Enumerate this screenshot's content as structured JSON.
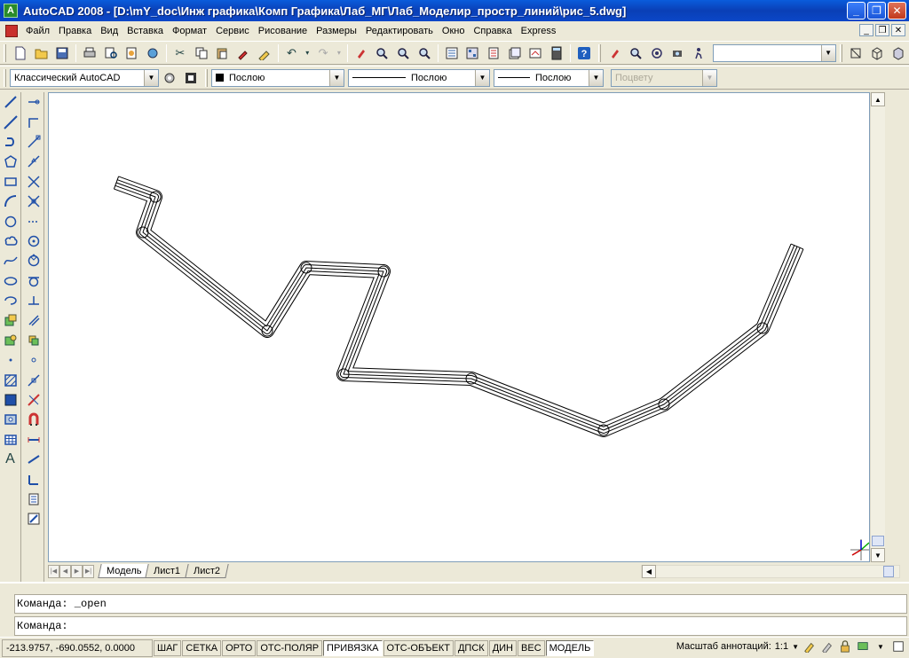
{
  "window": {
    "title": "AutoCAD 2008 - [D:\\mY_doc\\Инж графика\\Комп Графика\\Лаб_МГ\\Лаб_Моделир_простр_линий\\рис_5.dwg]",
    "icon_label": "A"
  },
  "menu": {
    "items": [
      {
        "label": "Файл"
      },
      {
        "label": "Правка"
      },
      {
        "label": "Вид"
      },
      {
        "label": "Вставка"
      },
      {
        "label": "Формат"
      },
      {
        "label": "Сервис"
      },
      {
        "label": "Рисование"
      },
      {
        "label": "Размеры"
      },
      {
        "label": "Редактировать"
      },
      {
        "label": "Окно"
      },
      {
        "label": "Справка"
      },
      {
        "label": "Express"
      }
    ]
  },
  "toolbar2": {
    "workspace": "Классический AutoCAD",
    "layer": "Послою",
    "linetype": "Послою",
    "lineweight": "Послою",
    "plotstyle": "Поцвету"
  },
  "tabs": [
    {
      "label": "Модель",
      "active": true
    },
    {
      "label": "Лист1",
      "active": false
    },
    {
      "label": "Лист2",
      "active": false
    }
  ],
  "command": {
    "history": "Команда:  _open",
    "prompt": "Команда:"
  },
  "status": {
    "coordinates": "-213.9757, -690.0552, 0.0000",
    "toggles": [
      {
        "label": "ШАГ",
        "on": false
      },
      {
        "label": "СЕТКА",
        "on": false
      },
      {
        "label": "ОРТО",
        "on": false
      },
      {
        "label": "ОТС-ПОЛЯР",
        "on": false
      },
      {
        "label": "ПРИВЯЗКА",
        "on": true
      },
      {
        "label": "ОТС-ОБЪЕКТ",
        "on": false
      },
      {
        "label": "ДПСК",
        "on": false
      },
      {
        "label": "ДИН",
        "on": false
      },
      {
        "label": "ВЕС",
        "on": false
      },
      {
        "label": "МОДЕЛЬ",
        "on": true
      }
    ],
    "annotation_scale_label": "Масштаб аннотаций:",
    "annotation_scale_value": "1:1"
  },
  "icons": {
    "toolbar1": [
      "new-icon",
      "open-icon",
      "save-icon",
      "plot-icon",
      "plot-preview-icon",
      "publish-icon",
      "3d-dwf-icon",
      "cut-icon",
      "copy-icon",
      "paste-icon",
      "match-properties-icon",
      "block-editor-icon",
      "undo-icon",
      "redo-icon",
      "pan-icon",
      "zoom-realtime-icon",
      "zoom-window-icon",
      "zoom-previous-icon",
      "properties-icon",
      "design-center-icon",
      "tool-palettes-icon",
      "sheet-set-icon",
      "markup-icon",
      "calculator-icon",
      "help-icon"
    ],
    "draw": [
      "line-icon",
      "construction-line-icon",
      "polyline-icon",
      "polygon-icon",
      "rectangle-icon",
      "arc-icon",
      "circle-icon",
      "revcloud-icon",
      "spline-icon",
      "ellipse-icon",
      "ellipse-arc-icon",
      "insert-block-icon",
      "make-block-icon",
      "point-icon",
      "hatch-icon",
      "gradient-icon",
      "region-icon",
      "table-icon",
      "multiline-text-icon"
    ],
    "modify": [
      "erase-icon",
      "copy-object-icon",
      "mirror-icon",
      "offset-icon",
      "array-icon",
      "move-icon",
      "rotate-icon",
      "scale-icon",
      "stretch-icon",
      "trim-icon",
      "extend-icon",
      "break-at-point-icon",
      "break-icon",
      "join-icon",
      "chamfer-icon",
      "fillet-icon",
      "explode-icon",
      "draworder-front-icon",
      "draworder-back-icon",
      "draworder-above-icon",
      "draworder-under-icon"
    ]
  },
  "colors": {
    "titlebar": "#0a4ed0",
    "canvas": "#ffffff",
    "chrome": "#ece9d8"
  }
}
